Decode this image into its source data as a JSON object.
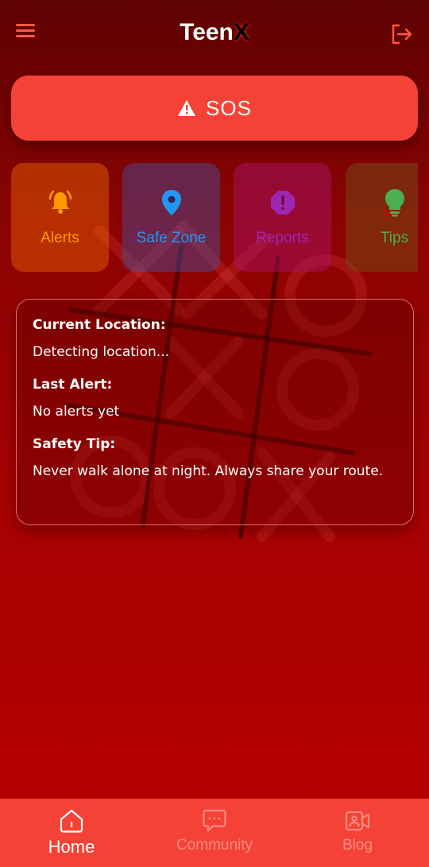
{
  "header": {
    "brand_prefix": "Teen",
    "brand_suffix": "X"
  },
  "sos": {
    "label": "SOS",
    "icon": "warning-icon"
  },
  "features": [
    {
      "label": "Alerts",
      "icon": "bell-icon",
      "color": "#ff9800"
    },
    {
      "label": "Safe Zone",
      "icon": "location-pin-icon",
      "color": "#2196f3"
    },
    {
      "label": "Reports",
      "icon": "report-octagon-icon",
      "color": "#9c27b0"
    },
    {
      "label": "Tips",
      "icon": "lightbulb-icon",
      "color": "#4caf50"
    }
  ],
  "info": {
    "location_heading": "Current Location:",
    "location_value": "Detecting location...",
    "alert_heading": "Last Alert:",
    "alert_value": "No alerts yet",
    "tip_heading": "Safety Tip:",
    "tip_value": "Never walk alone at night. Always share your route."
  },
  "nav": [
    {
      "label": "Home",
      "icon": "home-icon",
      "active": true
    },
    {
      "label": "Community",
      "icon": "chat-icon",
      "active": false
    },
    {
      "label": "Blog",
      "icon": "video-icon",
      "active": false
    }
  ],
  "colors": {
    "accent": "#f44336",
    "nav_active": "#ffffff",
    "nav_inactive": "#ff8a80"
  }
}
